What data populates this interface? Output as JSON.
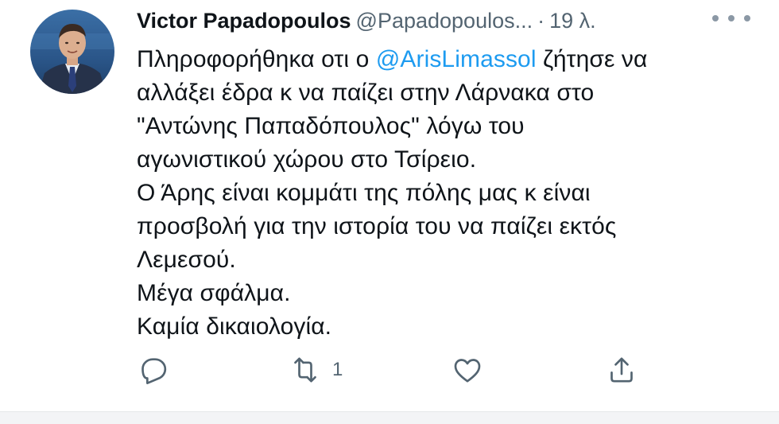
{
  "tweet": {
    "author": {
      "name": "Victor Papadopoulos",
      "handle": "@Papadopoulos...",
      "separator": "·",
      "time": "19 λ."
    },
    "body": {
      "lines": [
        {
          "before": "Πληροφορήθηκα οτι ο ",
          "mention": "@ArisLimassol",
          "after": " ζήτησε να"
        },
        {
          "text": "αλλάξει έδρα κ να παίζει στην Λάρνακα στο"
        },
        {
          "text": "\"Αντώνης Παπαδόπουλος\" λόγω του"
        },
        {
          "text": "αγωνιστικού χώρου στο Τσίρειο."
        },
        {
          "text": "Ο Άρης είναι κομμάτι της πόλης μας κ είναι"
        },
        {
          "text": "προσβολή για την ιστορία του να παίζει εκτός"
        },
        {
          "text": "Λεμεσού."
        },
        {
          "text": "Μέγα σφάλμα."
        },
        {
          "text": "Καμία δικαιολογία."
        }
      ]
    },
    "actions": {
      "reply": {
        "icon": "reply-icon",
        "count": ""
      },
      "retweet": {
        "icon": "retweet-icon",
        "count": "1"
      },
      "like": {
        "icon": "heart-icon",
        "count": ""
      },
      "share": {
        "icon": "share-icon",
        "count": ""
      }
    },
    "colors": {
      "link": "#1d9bf0",
      "secondary_text": "#536471",
      "primary_text": "#0f1419"
    }
  }
}
